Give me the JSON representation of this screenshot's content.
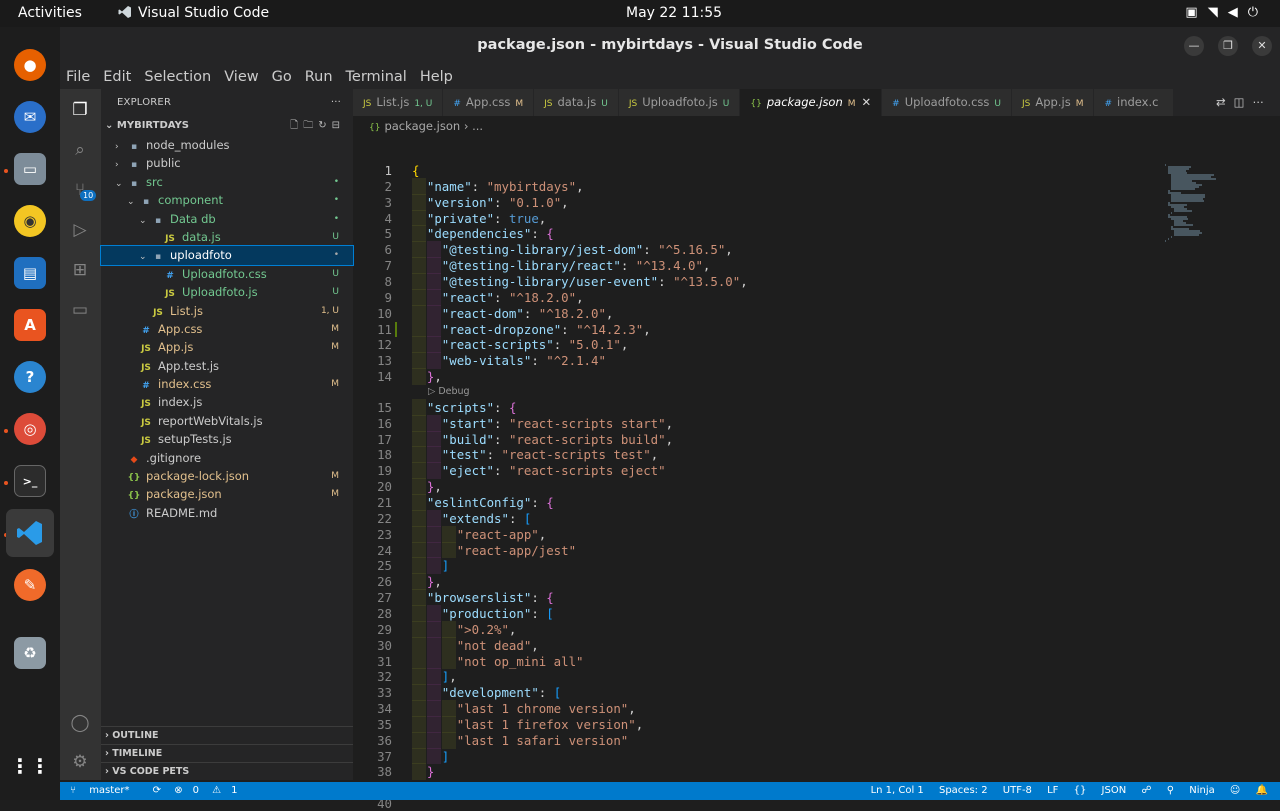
{
  "topbar": {
    "activities": "Activities",
    "app_name": "Visual Studio Code",
    "clock": "May 22  11:55"
  },
  "window": {
    "title": "package.json - mybirtdays - Visual Studio Code",
    "menu": [
      "File",
      "Edit",
      "Selection",
      "View",
      "Go",
      "Run",
      "Terminal",
      "Help"
    ]
  },
  "activity_bar": {
    "scm_badge": "10"
  },
  "explorer": {
    "header": "EXPLORER",
    "project": "MYBIRTDAYS",
    "tree": [
      {
        "label": "node_modules",
        "depth": 1,
        "chev": "›",
        "icon": "folder",
        "status": "",
        "cls": "c-plain"
      },
      {
        "label": "public",
        "depth": 1,
        "chev": "›",
        "icon": "folder",
        "status": "",
        "cls": "c-plain"
      },
      {
        "label": "src",
        "depth": 1,
        "chev": "⌄",
        "icon": "folder",
        "status": "•",
        "cls": "c-untracked"
      },
      {
        "label": "component",
        "depth": 2,
        "chev": "⌄",
        "icon": "folder",
        "status": "•",
        "cls": "c-untracked"
      },
      {
        "label": "Data db",
        "depth": 3,
        "chev": "⌄",
        "icon": "folder",
        "status": "•",
        "cls": "c-untracked"
      },
      {
        "label": "data.js",
        "depth": 4,
        "chev": "",
        "icon": "js",
        "status": "U",
        "cls": "c-untracked"
      },
      {
        "label": "uploadfoto",
        "depth": 3,
        "chev": "⌄",
        "icon": "folder",
        "status": "•",
        "cls": "c-plain",
        "selected": true
      },
      {
        "label": "Uploadfoto.css",
        "depth": 4,
        "chev": "",
        "icon": "css",
        "status": "U",
        "cls": "c-untracked"
      },
      {
        "label": "Uploadfoto.js",
        "depth": 4,
        "chev": "",
        "icon": "js",
        "status": "U",
        "cls": "c-untracked"
      },
      {
        "label": "List.js",
        "depth": 3,
        "chev": "",
        "icon": "js",
        "status": "1, U",
        "cls": "c-mod"
      },
      {
        "label": "App.css",
        "depth": 2,
        "chev": "",
        "icon": "css",
        "status": "M",
        "cls": "c-mod"
      },
      {
        "label": "App.js",
        "depth": 2,
        "chev": "",
        "icon": "js",
        "status": "M",
        "cls": "c-mod"
      },
      {
        "label": "App.test.js",
        "depth": 2,
        "chev": "",
        "icon": "js",
        "status": "",
        "cls": "c-plain"
      },
      {
        "label": "index.css",
        "depth": 2,
        "chev": "",
        "icon": "css",
        "status": "M",
        "cls": "c-mod"
      },
      {
        "label": "index.js",
        "depth": 2,
        "chev": "",
        "icon": "js",
        "status": "",
        "cls": "c-plain"
      },
      {
        "label": "reportWebVitals.js",
        "depth": 2,
        "chev": "",
        "icon": "js",
        "status": "",
        "cls": "c-plain"
      },
      {
        "label": "setupTests.js",
        "depth": 2,
        "chev": "",
        "icon": "js",
        "status": "",
        "cls": "c-plain"
      },
      {
        "label": ".gitignore",
        "depth": 1,
        "chev": "",
        "icon": "git",
        "status": "",
        "cls": "c-plain"
      },
      {
        "label": "package-lock.json",
        "depth": 1,
        "chev": "",
        "icon": "json",
        "status": "M",
        "cls": "c-mod"
      },
      {
        "label": "package.json",
        "depth": 1,
        "chev": "",
        "icon": "json",
        "status": "M",
        "cls": "c-mod"
      },
      {
        "label": "README.md",
        "depth": 1,
        "chev": "",
        "icon": "info",
        "status": "",
        "cls": "c-plain"
      }
    ],
    "sections": [
      "OUTLINE",
      "TIMELINE",
      "VS CODE PETS"
    ]
  },
  "tabs": [
    {
      "label": "List.js",
      "status": "1, U",
      "icon": "js",
      "active": false
    },
    {
      "label": "App.css",
      "status": "M",
      "icon": "css",
      "active": false
    },
    {
      "label": "data.js",
      "status": "U",
      "icon": "js",
      "active": false
    },
    {
      "label": "Uploadfoto.js",
      "status": "U",
      "icon": "js",
      "active": false
    },
    {
      "label": "package.json",
      "status": "M",
      "icon": "json",
      "active": true
    },
    {
      "label": "Uploadfoto.css",
      "status": "U",
      "icon": "css",
      "active": false
    },
    {
      "label": "App.js",
      "status": "M",
      "icon": "js",
      "active": false
    },
    {
      "label": "index.c",
      "status": "",
      "icon": "css",
      "active": false
    }
  ],
  "breadcrumb": {
    "file": "package.json",
    "rest": "..."
  },
  "editor": {
    "codelens": "Debug",
    "lines": [
      [
        [
          "p1",
          "{"
        ]
      ],
      [
        [
          "k",
          "\"name\""
        ],
        [
          "t",
          ": "
        ],
        [
          "s",
          "\"mybirtdays\""
        ],
        [
          "t",
          ","
        ]
      ],
      [
        [
          "k",
          "\"version\""
        ],
        [
          "t",
          ": "
        ],
        [
          "s",
          "\"0.1.0\""
        ],
        [
          "t",
          ","
        ]
      ],
      [
        [
          "k",
          "\"private\""
        ],
        [
          "t",
          ": "
        ],
        [
          "b",
          "true"
        ],
        [
          "t",
          ","
        ]
      ],
      [
        [
          "k",
          "\"dependencies\""
        ],
        [
          "t",
          ": "
        ],
        [
          "p2",
          "{"
        ]
      ],
      [
        [
          "k",
          "\"@testing-library/jest-dom\""
        ],
        [
          "t",
          ": "
        ],
        [
          "s",
          "\"^5.16.5\""
        ],
        [
          "t",
          ","
        ]
      ],
      [
        [
          "k",
          "\"@testing-library/react\""
        ],
        [
          "t",
          ": "
        ],
        [
          "s",
          "\"^13.4.0\""
        ],
        [
          "t",
          ","
        ]
      ],
      [
        [
          "k",
          "\"@testing-library/user-event\""
        ],
        [
          "t",
          ": "
        ],
        [
          "s",
          "\"^13.5.0\""
        ],
        [
          "t",
          ","
        ]
      ],
      [
        [
          "k",
          "\"react\""
        ],
        [
          "t",
          ": "
        ],
        [
          "s",
          "\"^18.2.0\""
        ],
        [
          "t",
          ","
        ]
      ],
      [
        [
          "k",
          "\"react-dom\""
        ],
        [
          "t",
          ": "
        ],
        [
          "s",
          "\"^18.2.0\""
        ],
        [
          "t",
          ","
        ]
      ],
      [
        [
          "k",
          "\"react-dropzone\""
        ],
        [
          "t",
          ": "
        ],
        [
          "s",
          "\"^14.2.3\""
        ],
        [
          "t",
          ","
        ]
      ],
      [
        [
          "k",
          "\"react-scripts\""
        ],
        [
          "t",
          ": "
        ],
        [
          "s",
          "\"5.0.1\""
        ],
        [
          "t",
          ","
        ]
      ],
      [
        [
          "k",
          "\"web-vitals\""
        ],
        [
          "t",
          ": "
        ],
        [
          "s",
          "\"^2.1.4\""
        ]
      ],
      [
        [
          "p2",
          "}"
        ],
        [
          "t",
          ","
        ]
      ],
      [
        [
          "k",
          "\"scripts\""
        ],
        [
          "t",
          ": "
        ],
        [
          "p2",
          "{"
        ]
      ],
      [
        [
          "k",
          "\"start\""
        ],
        [
          "t",
          ": "
        ],
        [
          "s",
          "\"react-scripts start\""
        ],
        [
          "t",
          ","
        ]
      ],
      [
        [
          "k",
          "\"build\""
        ],
        [
          "t",
          ": "
        ],
        [
          "s",
          "\"react-scripts build\""
        ],
        [
          "t",
          ","
        ]
      ],
      [
        [
          "k",
          "\"test\""
        ],
        [
          "t",
          ": "
        ],
        [
          "s",
          "\"react-scripts test\""
        ],
        [
          "t",
          ","
        ]
      ],
      [
        [
          "k",
          "\"eject\""
        ],
        [
          "t",
          ": "
        ],
        [
          "s",
          "\"react-scripts eject\""
        ]
      ],
      [
        [
          "p2",
          "}"
        ],
        [
          "t",
          ","
        ]
      ],
      [
        [
          "k",
          "\"eslintConfig\""
        ],
        [
          "t",
          ": "
        ],
        [
          "p2",
          "{"
        ]
      ],
      [
        [
          "k",
          "\"extends\""
        ],
        [
          "t",
          ": "
        ],
        [
          "p3",
          "["
        ]
      ],
      [
        [
          "s",
          "\"react-app\""
        ],
        [
          "t",
          ","
        ]
      ],
      [
        [
          "s",
          "\"react-app/jest\""
        ]
      ],
      [
        [
          "p3",
          "]"
        ]
      ],
      [
        [
          "p2",
          "}"
        ],
        [
          "t",
          ","
        ]
      ],
      [
        [
          "k",
          "\"browserslist\""
        ],
        [
          "t",
          ": "
        ],
        [
          "p2",
          "{"
        ]
      ],
      [
        [
          "k",
          "\"production\""
        ],
        [
          "t",
          ": "
        ],
        [
          "p3",
          "["
        ]
      ],
      [
        [
          "s",
          "\">0.2%\""
        ],
        [
          "t",
          ","
        ]
      ],
      [
        [
          "s",
          "\"not dead\""
        ],
        [
          "t",
          ","
        ]
      ],
      [
        [
          "s",
          "\"not op_mini all\""
        ]
      ],
      [
        [
          "p3",
          "]"
        ],
        [
          "t",
          ","
        ]
      ],
      [
        [
          "k",
          "\"development\""
        ],
        [
          "t",
          ": "
        ],
        [
          "p3",
          "["
        ]
      ],
      [
        [
          "s",
          "\"last 1 chrome version\""
        ],
        [
          "t",
          ","
        ]
      ],
      [
        [
          "s",
          "\"last 1 firefox version\""
        ],
        [
          "t",
          ","
        ]
      ],
      [
        [
          "s",
          "\"last 1 safari version\""
        ]
      ],
      [
        [
          "p3",
          "]"
        ]
      ],
      [
        [
          "p2",
          "}"
        ]
      ],
      [
        [
          "p1",
          "}"
        ]
      ],
      []
    ],
    "indents": [
      0,
      1,
      1,
      1,
      1,
      2,
      2,
      2,
      2,
      2,
      2,
      2,
      2,
      1,
      1,
      2,
      2,
      2,
      2,
      1,
      1,
      2,
      3,
      3,
      2,
      1,
      1,
      2,
      3,
      3,
      3,
      2,
      2,
      3,
      3,
      3,
      2,
      1,
      0,
      0
    ]
  },
  "statusbar": {
    "branch": "master*",
    "problems": "0",
    "warnings": "1",
    "position": "Ln 1, Col 1",
    "spaces": "Spaces: 2",
    "encoding": "UTF-8",
    "eol": "LF",
    "language": "JSON",
    "ninja": "Ninja"
  }
}
